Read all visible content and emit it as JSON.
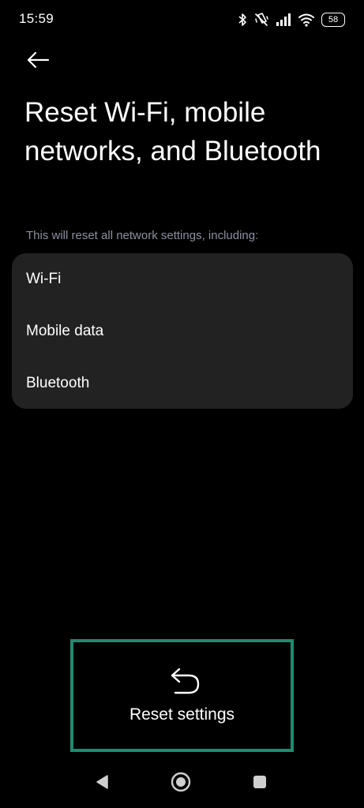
{
  "status_bar": {
    "time": "15:59",
    "battery": "58",
    "icons": [
      "bluetooth-icon",
      "vibrate-off-icon",
      "signal-icon",
      "wifi-icon",
      "battery-icon"
    ]
  },
  "header": {
    "back_icon": "arrow-left-icon",
    "title": "Reset Wi-Fi, mobile networks, and Bluetooth"
  },
  "main": {
    "subtitle": "This will reset all network settings, including:",
    "items": [
      {
        "label": "Wi-Fi"
      },
      {
        "label": "Mobile data"
      },
      {
        "label": "Bluetooth"
      }
    ]
  },
  "action": {
    "label": "Reset settings",
    "icon": "undo-icon",
    "highlight_color": "#1f8a6e"
  },
  "nav": {
    "back": "triangle-back-icon",
    "home": "circle-home-icon",
    "recents": "square-recents-icon"
  },
  "colors": {
    "background": "#000000",
    "card": "#222222",
    "subtitle": "#8c8fa0",
    "text": "#ffffff"
  }
}
